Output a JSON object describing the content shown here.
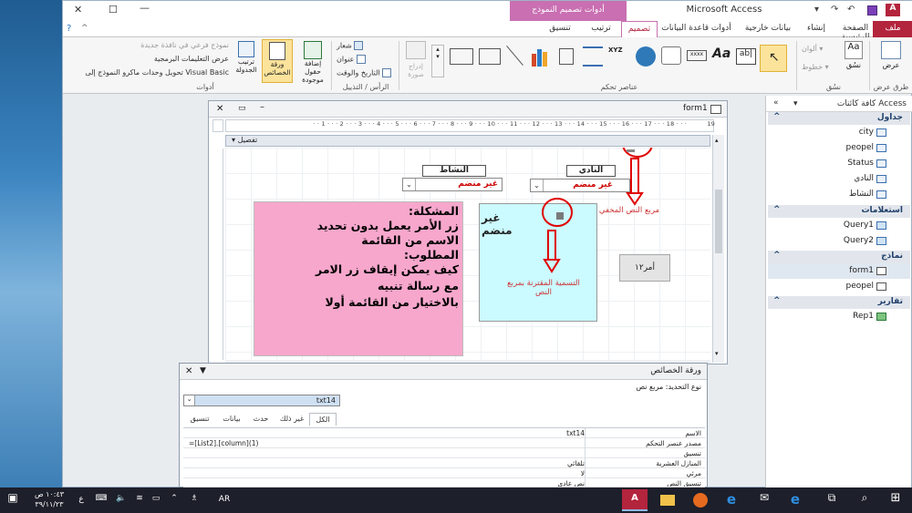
{
  "window": {
    "title": "Microsoft Access",
    "context_tab": "أدوات تصميم النموذج",
    "quick_access": [
      "save-icon",
      "undo-icon",
      "redo-icon"
    ]
  },
  "ribbon_tabs": [
    "ملف",
    "الصفحة الرئيسية",
    "إنشاء",
    "بيانات خارجية",
    "أدوات قاعدة البيانات",
    "تصميم",
    "ترتيب",
    "تنسيق"
  ],
  "ribbon": {
    "views_group": {
      "button": "عرض",
      "label": "طرق عرض"
    },
    "themes_group": {
      "label": "نسُق",
      "items": [
        "نسُق",
        "ألوان",
        "خطوط"
      ]
    },
    "controls_group": {
      "label": "عناصر تحكم"
    },
    "insert_image": "إدراج صورة",
    "header_group": {
      "label": "الرأس / التذييل",
      "items": [
        "شعار",
        "عنوان",
        "التاريخ والوقت"
      ]
    },
    "tools_group": {
      "label": "أدوات",
      "big_buttons": [
        "إضافة حقول موجودة",
        "ورقة الخصائص",
        "ترتيب الجدولة"
      ],
      "items": [
        "نموذج فرعي في نافذة جديدة",
        "عرض التعليمات البرمجية",
        "تحويل وحدات ماكرو النموذج إلى Visual Basic"
      ]
    }
  },
  "nav": {
    "title": "كافة كائنات Access",
    "sections": [
      {
        "name": "جداول",
        "items": [
          "city",
          "peopel",
          "Status",
          "النادي",
          "النشاط"
        ]
      },
      {
        "name": "استعلامات",
        "items": [
          "Query1",
          "Query2"
        ]
      },
      {
        "name": "نماذج",
        "items": [
          "form1",
          "peopel"
        ],
        "selected": "form1"
      },
      {
        "name": "تقارير",
        "items": [
          "Rep1"
        ]
      }
    ]
  },
  "form": {
    "title": "form1",
    "section": "تفصيل",
    "ruler_numbers": [
      "1",
      "2",
      "3",
      "4",
      "5",
      "6",
      "7",
      "8",
      "9",
      "10",
      "11",
      "12",
      "13",
      "14",
      "15",
      "16",
      "17",
      "18",
      "19"
    ],
    "label_activity": "النشاط",
    "label_club": "النادي",
    "combo_activity_value": "غير منضم",
    "combo_club_value": "غير منضم",
    "pink_lines": [
      "المشكلة:",
      "زر الأمر يعمل بدون تحديد",
      "الاسم من القائمة",
      "المطلوب:",
      "كيف يمكن إيقاف زر الامر",
      "مع رسالة تنبيه",
      "بالاختيار من القائمة أولا"
    ],
    "cyan_text": "غير منضم",
    "cyan_note": "التسمية المقترنة بمربع النص",
    "button_text": "أمر١٢",
    "hidden_note": "مربع النص المخفي",
    "annotation_color": "#e00000"
  },
  "property_sheet": {
    "title": "ورقة الخصائص",
    "selection_type": "نوع التحديد:  مربع نص",
    "selected_control": "txt14",
    "tabs": [
      "تنسيق",
      "بيانات",
      "حدث",
      "غير ذلك",
      "الكل"
    ],
    "selected_tab": "الكل",
    "rows": [
      {
        "name": "الاسم",
        "value": "txt14"
      },
      {
        "name": "مصدر عنصر التحكم",
        "value": "=[List2].[column](1)"
      },
      {
        "name": "تنسيق",
        "value": ""
      },
      {
        "name": "المنازل العشرية",
        "value": "تلقائي"
      },
      {
        "name": "مرئي",
        "value": "لا"
      },
      {
        "name": "تنسيق النص",
        "value": "نص عادي"
      }
    ]
  },
  "taskbar": {
    "time": "١٠:٤٣ ص",
    "date": "٣٩/١١/٢٣",
    "lang": "AR",
    "ime": "ع"
  }
}
